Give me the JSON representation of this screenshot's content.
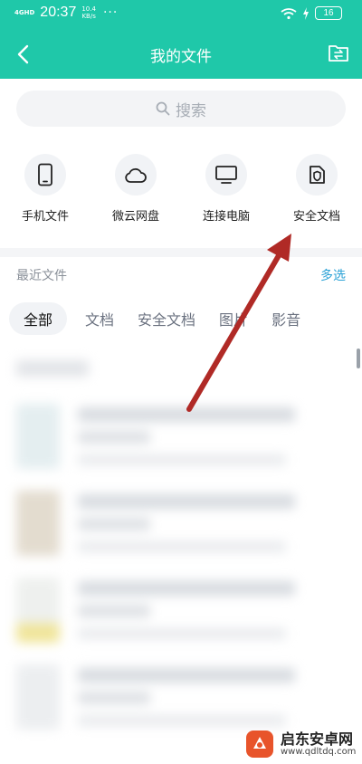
{
  "status_bar": {
    "signal": "4GHD",
    "time": "20:37",
    "speed_value": "10.4",
    "speed_unit": "KB/s",
    "more": "···",
    "battery": "16"
  },
  "header": {
    "title": "我的文件",
    "back_icon": "chevron-left-icon",
    "folder_icon": "folder-transfer-icon"
  },
  "search": {
    "placeholder": "搜索",
    "icon": "search-icon"
  },
  "categories": [
    {
      "label": "手机文件",
      "icon": "phone-icon"
    },
    {
      "label": "微云网盘",
      "icon": "cloud-icon"
    },
    {
      "label": "连接电脑",
      "icon": "monitor-icon"
    },
    {
      "label": "安全文档",
      "icon": "shield-doc-icon"
    }
  ],
  "recent": {
    "title": "最近文件",
    "multi_select": "多选"
  },
  "tabs": [
    {
      "label": "全部",
      "active": true
    },
    {
      "label": "文档",
      "active": false
    },
    {
      "label": "安全文档",
      "active": false
    },
    {
      "label": "图片",
      "active": false
    },
    {
      "label": "影音",
      "active": false
    }
  ],
  "colors": {
    "header": "#1fc8a9",
    "accent": "#2aa1d6",
    "arrow": "#b02a26"
  },
  "watermark": {
    "title": "启东安卓网",
    "url": "www.qdltdq.com"
  }
}
